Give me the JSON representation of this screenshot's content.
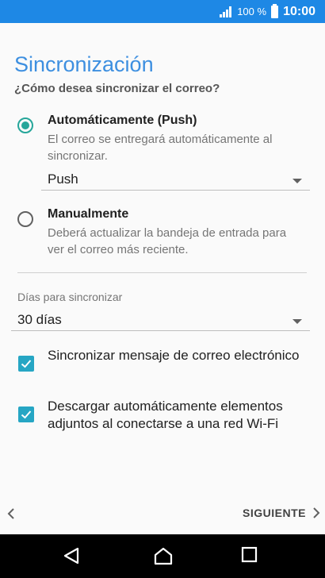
{
  "status": {
    "battery_pct": "100 %",
    "time": "10:00"
  },
  "page": {
    "title": "Sincronización",
    "subtitle": "¿Cómo desea sincronizar el correo?"
  },
  "options": {
    "auto": {
      "title": "Automáticamente (Push)",
      "desc": "El correo se entregará automáticamente al sincronizar.",
      "selected": true,
      "dropdown_value": "Push"
    },
    "manual": {
      "title": "Manualmente",
      "desc": "Deberá actualizar la bandeja de entrada para ver el correo más reciente.",
      "selected": false
    }
  },
  "sync_days": {
    "label": "Días para sincronizar",
    "value": "30 días"
  },
  "checkboxes": [
    {
      "label": "Sincronizar mensaje de correo electrónico",
      "checked": true
    },
    {
      "label": "Descargar automáticamente elementos adjuntos al conectarse a una red Wi-Fi",
      "checked": true
    }
  ],
  "footer": {
    "next_label": "SIGUIENTE"
  },
  "colors": {
    "accent": "#26a69a",
    "title": "#3d8fe0",
    "status_bar": "#1e88e5",
    "checkbox": "#26a6c4"
  },
  "icons": [
    "signal-icon",
    "battery-icon",
    "back-icon",
    "next-icon",
    "nav-back-icon",
    "nav-home-icon",
    "nav-recents-icon"
  ]
}
